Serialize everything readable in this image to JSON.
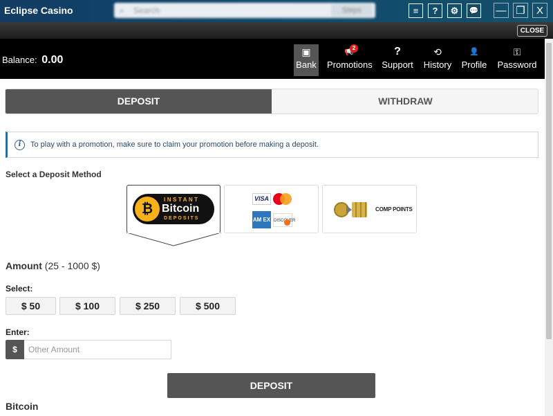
{
  "window": {
    "title": "Eclipse Casino",
    "search_placeholder": "Search",
    "search_button": "Steps",
    "tb_buttons": [
      "≡",
      "?",
      "⚙",
      "💬"
    ],
    "win_buttons": [
      "—",
      "❐",
      "X"
    ]
  },
  "close_label": "CLOSE",
  "header": {
    "balance_label": "Balance:",
    "balance_value": "0.00",
    "nav": [
      {
        "label": "Bank",
        "icon": "bank-icon",
        "glyph": "▣"
      },
      {
        "label": "Promotions",
        "icon": "megaphone-icon",
        "glyph": "📢",
        "badge": "2"
      },
      {
        "label": "Support",
        "icon": "question-icon",
        "glyph": "?"
      },
      {
        "label": "History",
        "icon": "history-icon",
        "glyph": "⟲"
      },
      {
        "label": "Profile",
        "icon": "user-icon",
        "glyph": "👤"
      },
      {
        "label": "Password",
        "icon": "key-icon",
        "glyph": "⚿"
      }
    ]
  },
  "tabs": {
    "deposit": "DEPOSIT",
    "withdraw": "WITHDRAW"
  },
  "info": {
    "text": "To play with a promotion, make sure to claim your promotion before making a deposit."
  },
  "methods": {
    "label": "Select a Deposit Method",
    "bitcoin": {
      "top": "INSTANT",
      "mid": "Bitcoin",
      "bot": "DEPOSITS"
    },
    "cards": {
      "visa": "VISA",
      "amex": "AM EX",
      "discover": "DISCOVER"
    },
    "comp": "COMP POINTS"
  },
  "amount": {
    "title": "Amount",
    "range": "(25 - 1000 $)",
    "select_label": "Select:",
    "presets": [
      "$ 50",
      "$ 100",
      "$ 250",
      "$ 500"
    ],
    "enter_label": "Enter:",
    "currency": "$",
    "placeholder": "Other Amount"
  },
  "deposit_button": "DEPOSIT",
  "section_heading": "Bitcoin",
  "colors": {
    "accent": "#555555",
    "header": "#000000",
    "titlebar": "#123c63",
    "badge": "#e02020",
    "bitcoin": "#f7b21a"
  }
}
